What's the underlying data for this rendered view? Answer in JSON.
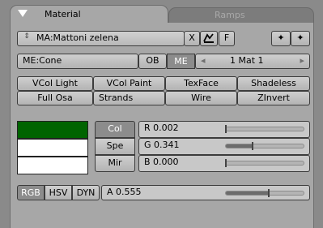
{
  "tabs": {
    "active_label": "Material",
    "inactive_label": "Ramps"
  },
  "material": {
    "updown_glyph": "⇕",
    "name": "MA:Mattoni zelena",
    "x_label": "X",
    "fake_user_icon": "fake-user-icon",
    "f_label": "F",
    "pin_icon_1": "pin-icon",
    "pin_icon_2": "pin-icon"
  },
  "link": {
    "me_label": "ME:Cone",
    "ob_label": "OB",
    "me_toggle_label": "ME",
    "index_left_arrow": "◂",
    "index_value": "1 Mat 1",
    "index_right_arrow": "▸"
  },
  "toggles_row1": [
    "VCol Light",
    "VCol Paint",
    "TexFace",
    "Shadeless"
  ],
  "toggles_row2": [
    "Full Osa",
    "Strands",
    "Wire",
    "ZInvert"
  ],
  "color_targets": [
    "Col",
    "Spe",
    "Mir"
  ],
  "rgb": [
    {
      "label": "R 0.002",
      "value": 0.002
    },
    {
      "label": "G 0.341",
      "value": 0.341
    },
    {
      "label": "B 0.000",
      "value": 0.0
    }
  ],
  "swatches": {
    "col": "#006400",
    "spe": "#ffffff",
    "mir": "#ffffff"
  },
  "mode": [
    "RGB",
    "HSV",
    "DYN"
  ],
  "alpha": {
    "label": "A 0.555",
    "value": 0.555
  },
  "colors": {
    "panel_bg": "#a7a7a7",
    "selected_btn": "#8c8c8c"
  }
}
